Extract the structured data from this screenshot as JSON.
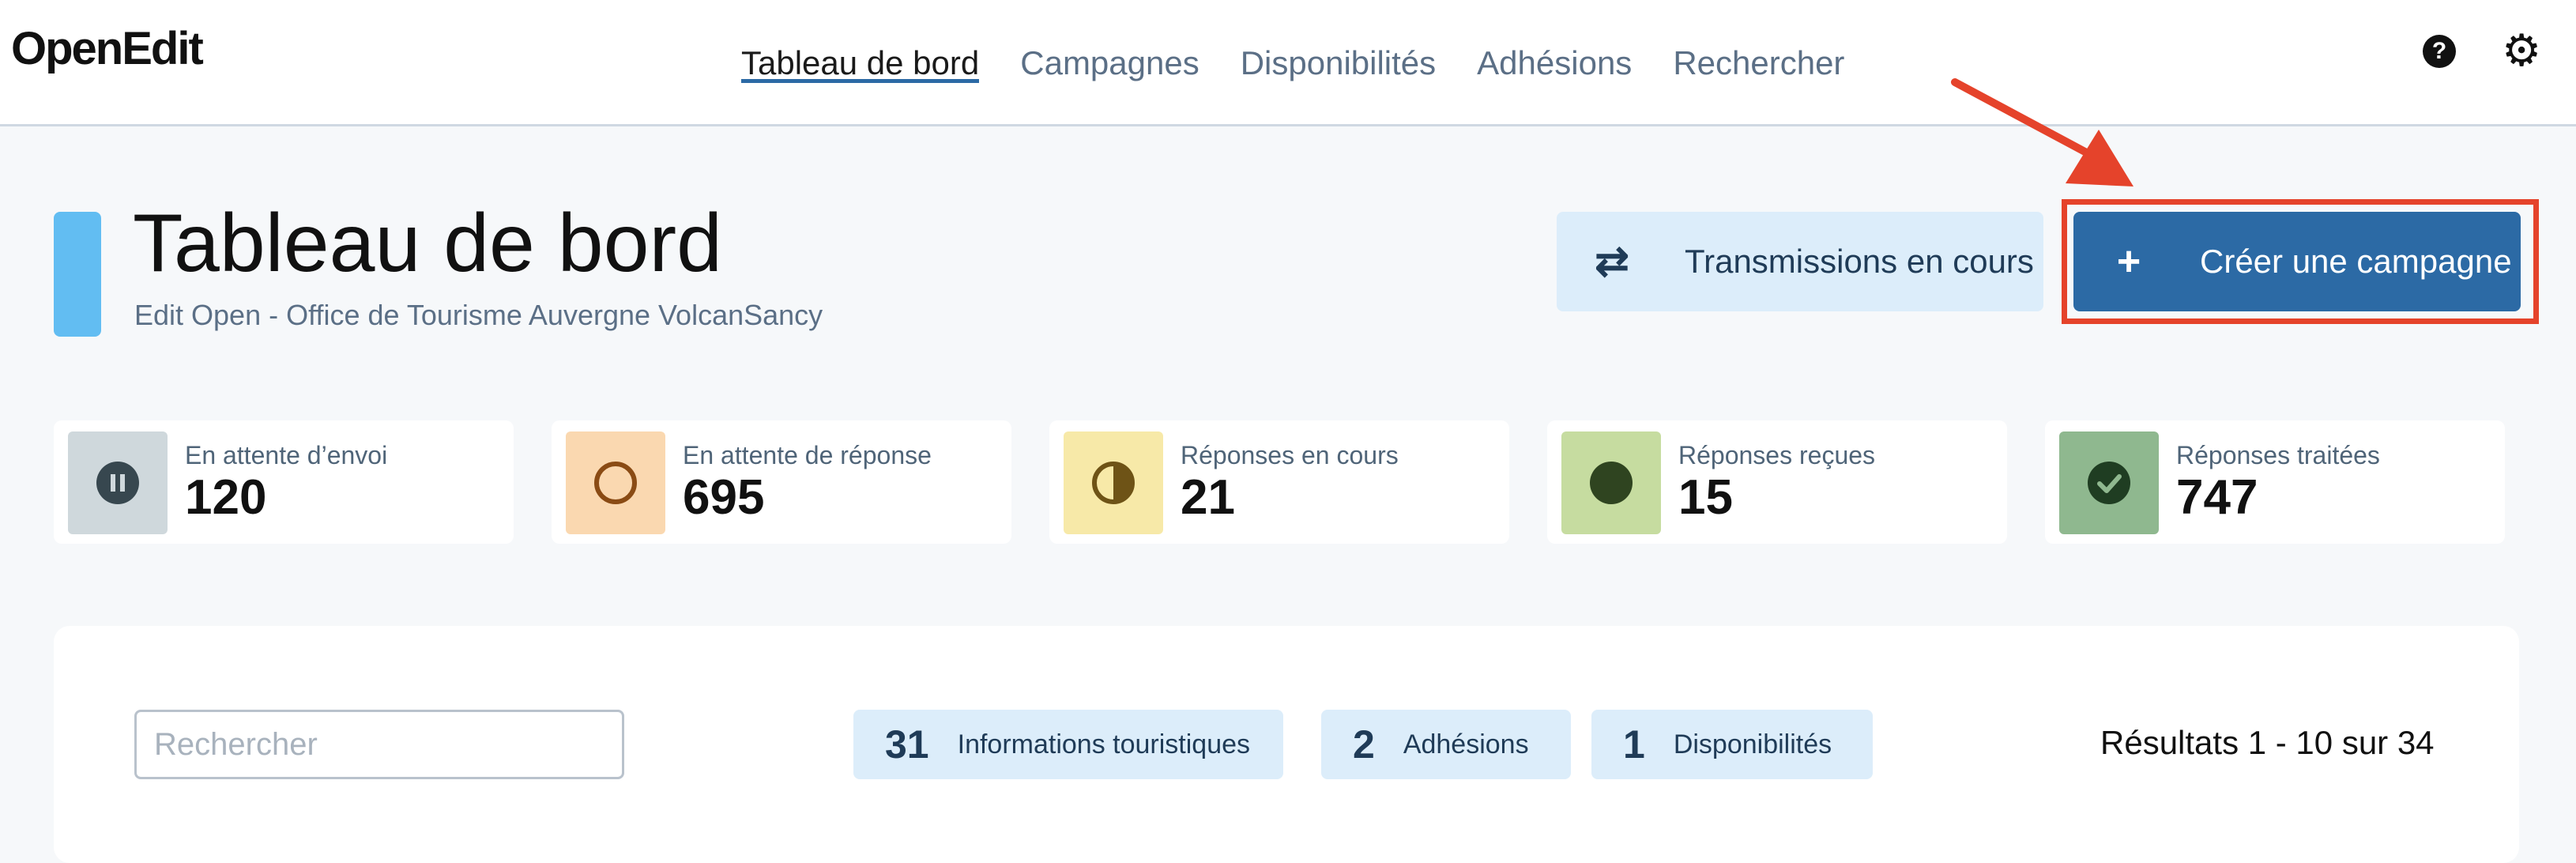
{
  "app": {
    "logo": "OpenEdit"
  },
  "nav": {
    "items": [
      {
        "label": "Tableau de bord",
        "active": true
      },
      {
        "label": "Campagnes"
      },
      {
        "label": "Disponibilités"
      },
      {
        "label": "Adhésions"
      },
      {
        "label": "Rechercher"
      }
    ],
    "icons": [
      "help-icon",
      "gear-icon"
    ]
  },
  "header": {
    "title": "Tableau de bord",
    "subtitle": "Edit Open - Office de Tourisme Auvergne VolcanSancy",
    "accent_color": "#62bdf2"
  },
  "actions": {
    "transmissions_label": "Transmissions en cours",
    "create_label": "Créer une campagne",
    "primary_color": "#2c6aa5",
    "highlight_color": "#e5432b"
  },
  "stats": [
    {
      "label": "En attente d’envoi",
      "value": "120",
      "icon": "pause-icon",
      "tile_color": "#cfd8dc",
      "icon_color": "#37474f"
    },
    {
      "label": "En attente de réponse",
      "value": "695",
      "icon": "empty-circle-icon",
      "tile_color": "#fad8b0",
      "icon_color": "#8a4b14"
    },
    {
      "label": "Réponses en cours",
      "value": "21",
      "icon": "half-circle-icon",
      "tile_color": "#f7e9a8",
      "icon_color": "#6e5316"
    },
    {
      "label": "Réponses reçues",
      "value": "15",
      "icon": "filled-circle-icon",
      "tile_color": "#c6dca0",
      "icon_color": "#2f4420"
    },
    {
      "label": "Réponses traitées",
      "value": "747",
      "icon": "check-circle-icon",
      "tile_color": "#8fb88f",
      "icon_color": "#1f3d22"
    }
  ],
  "search": {
    "placeholder": "Rechercher",
    "value": ""
  },
  "filters": [
    {
      "count": "31",
      "label": "Informations touristiques"
    },
    {
      "count": "2",
      "label": "Adhésions"
    },
    {
      "count": "1",
      "label": "Disponibilités"
    }
  ],
  "results_text": "Résultats 1 - 10 sur 34"
}
